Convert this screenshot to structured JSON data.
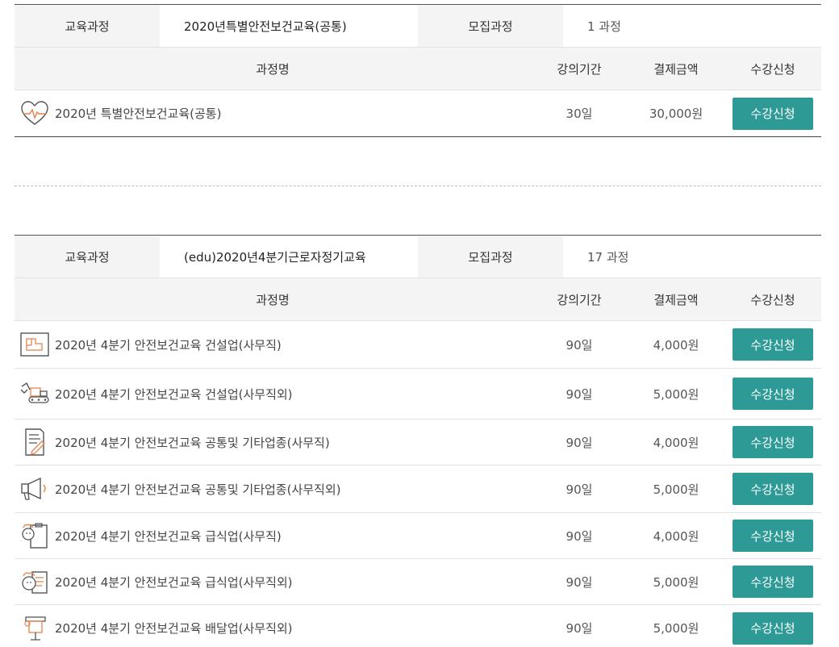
{
  "blocks": [
    {
      "info": {
        "course_label": "교육과정",
        "course_value": "2020년특별안전보건교육(공통)",
        "recruit_label": "모집과정",
        "recruit_value": "1 과정"
      },
      "headers": {
        "name": "과정명",
        "period": "강의기간",
        "price": "결제금액",
        "apply": "수강신청"
      },
      "rows": [
        {
          "icon": "heart-pulse-icon",
          "name": "2020년 특별안전보건교육(공통)",
          "period": "30일",
          "price": "30,000원",
          "button": "수강신청"
        }
      ]
    },
    {
      "info": {
        "course_label": "교육과정",
        "course_value": "(edu)2020년4분기근로자정기교육",
        "recruit_label": "모집과정",
        "recruit_value": "17 과정"
      },
      "headers": {
        "name": "과정명",
        "period": "강의기간",
        "price": "결제금액",
        "apply": "수강신청"
      },
      "rows": [
        {
          "icon": "blueprint-icon",
          "name": "2020년 4분기 안전보건교육 건설업(사무직)",
          "period": "90일",
          "price": "4,000원",
          "button": "수강신청"
        },
        {
          "icon": "excavator-icon",
          "name": "2020년 4분기 안전보건교육 건설업(사무직외)",
          "period": "90일",
          "price": "5,000원",
          "button": "수강신청"
        },
        {
          "icon": "document-pen-icon",
          "name": "2020년 4분기 안전보건교육 공통및 기타업종(사무직)",
          "period": "90일",
          "price": "4,000원",
          "button": "수강신청"
        },
        {
          "icon": "megaphone-icon",
          "name": "2020년 4분기 안전보건교육 공통및 기타업종(사무직외)",
          "period": "90일",
          "price": "5,000원",
          "button": "수강신청"
        },
        {
          "icon": "chef-clipboard-icon",
          "name": "2020년 4분기 안전보건교육 급식업(사무직)",
          "period": "90일",
          "price": "4,000원",
          "button": "수강신청"
        },
        {
          "icon": "chef-menu-icon",
          "name": "2020년 4분기 안전보건교육 급식업(사무직외)",
          "period": "90일",
          "price": "5,000원",
          "button": "수강신청"
        },
        {
          "icon": "delivery-icon",
          "name": "2020년 4분기 안전보건교육 배달업(사무직외)",
          "period": "90일",
          "price": "5,000원",
          "button": "수강신청"
        }
      ]
    }
  ],
  "colors": {
    "accent": "#2e9a96",
    "icon_orange": "#e8824a",
    "icon_gray": "#555555"
  }
}
